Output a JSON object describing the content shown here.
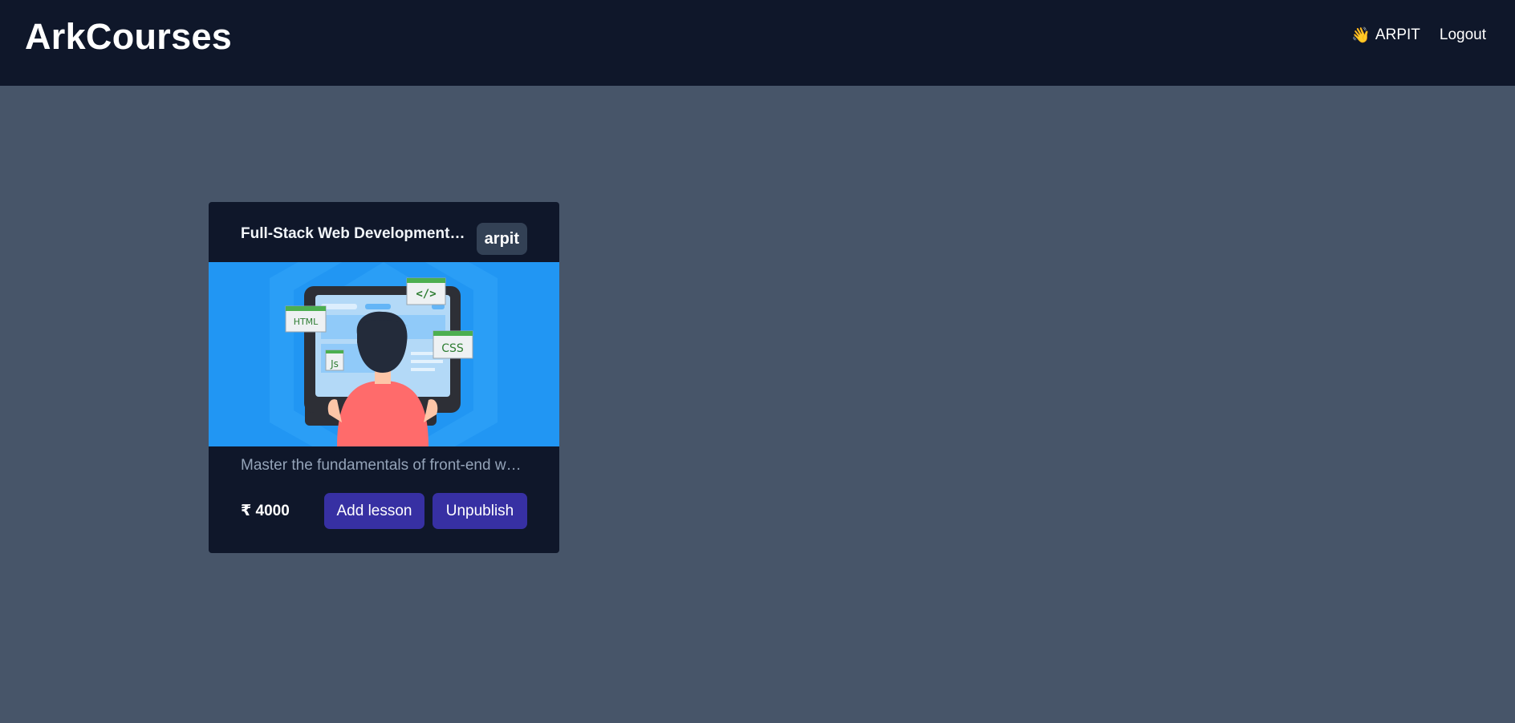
{
  "header": {
    "brand": "ArkCourses",
    "user_greeting_icon": "waving-hand-icon",
    "user_name": "ARPIT",
    "logout_label": "Logout"
  },
  "course_card": {
    "title": "Full-Stack Web Development Bootcamp",
    "author": "arpit",
    "description": "Master the fundamentals of front-end web development",
    "price": "₹ 4000",
    "add_lesson_label": "Add lesson",
    "unpublish_label": "Unpublish",
    "thumbnail": {
      "labels": {
        "html": "HTML",
        "code": "</>",
        "css": "CSS",
        "js": "Js"
      }
    }
  },
  "colors": {
    "page_background": "#475569",
    "navbar": "#0f172a",
    "card": "#0f172a",
    "badge": "#334155",
    "button": "#3730a3",
    "thumbnail_bg": "#2196f3"
  }
}
